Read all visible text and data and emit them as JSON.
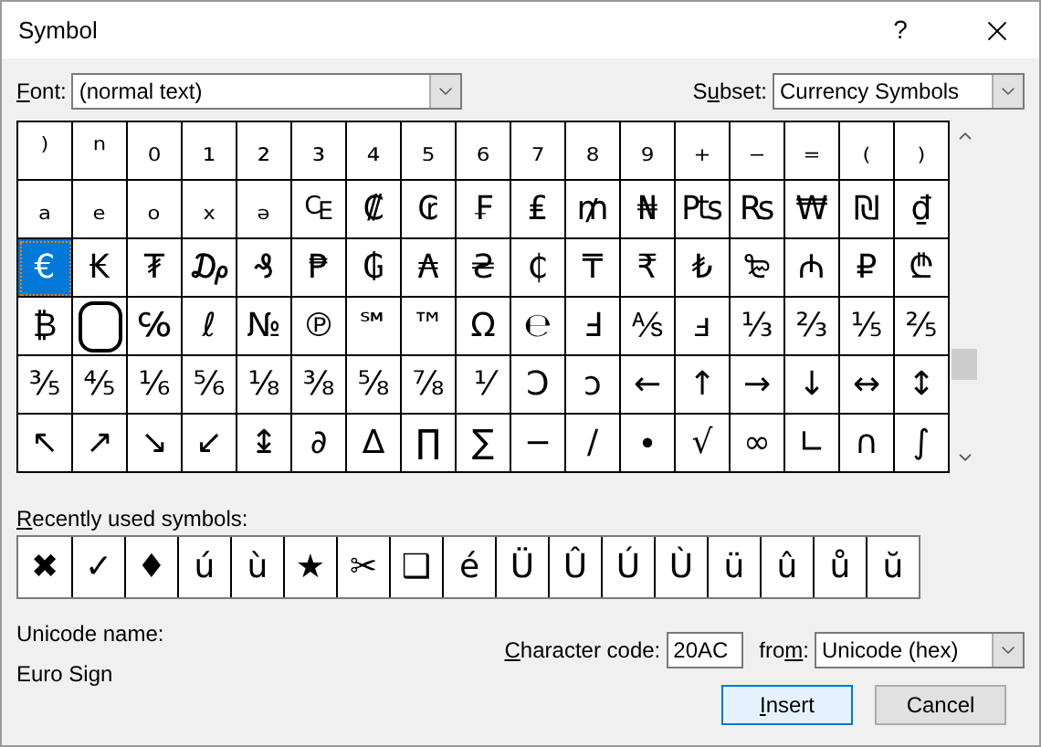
{
  "window": {
    "title": "Symbol",
    "help": "?"
  },
  "font": {
    "label": [
      {
        "text": "F",
        "underline": true
      },
      {
        "text": "ont:",
        "underline": false
      }
    ],
    "value": "(normal text)"
  },
  "subset": {
    "label": [
      {
        "text": "S",
        "underline": false
      },
      {
        "text": "u",
        "underline": true
      },
      {
        "text": "bset:",
        "underline": false
      }
    ],
    "value": "Currency Symbols"
  },
  "symbol_grid": [
    [
      {
        "char": "⁾",
        "selected": false
      },
      {
        "char": "ⁿ",
        "selected": false
      },
      {
        "char": "₀",
        "selected": false
      },
      {
        "char": "₁",
        "selected": false
      },
      {
        "char": "₂",
        "selected": false
      },
      {
        "char": "₃",
        "selected": false
      },
      {
        "char": "₄",
        "selected": false
      },
      {
        "char": "₅",
        "selected": false
      },
      {
        "char": "₆",
        "selected": false
      },
      {
        "char": "₇",
        "selected": false
      },
      {
        "char": "₈",
        "selected": false
      },
      {
        "char": "₉",
        "selected": false
      },
      {
        "char": "₊",
        "selected": false
      },
      {
        "char": "₋",
        "selected": false
      },
      {
        "char": "₌",
        "selected": false
      },
      {
        "char": "₍",
        "selected": false
      },
      {
        "char": "₎",
        "selected": false
      }
    ],
    [
      {
        "char": "ₐ",
        "selected": false
      },
      {
        "char": "ₑ",
        "selected": false
      },
      {
        "char": "ₒ",
        "selected": false
      },
      {
        "char": "ₓ",
        "selected": false
      },
      {
        "char": "ₔ",
        "selected": false
      },
      {
        "char": "₠",
        "selected": false
      },
      {
        "char": "₡",
        "selected": false
      },
      {
        "char": "₢",
        "selected": false
      },
      {
        "char": "₣",
        "selected": false
      },
      {
        "char": "₤",
        "selected": false
      },
      {
        "char": "₥",
        "selected": false
      },
      {
        "char": "₦",
        "selected": false
      },
      {
        "char": "₧",
        "selected": false
      },
      {
        "char": "₨",
        "selected": false
      },
      {
        "char": "₩",
        "selected": false
      },
      {
        "char": "₪",
        "selected": false
      },
      {
        "char": "₫",
        "selected": false
      }
    ],
    [
      {
        "char": "€",
        "selected": true
      },
      {
        "char": "₭",
        "selected": false
      },
      {
        "char": "₮",
        "selected": false
      },
      {
        "char": "₯",
        "selected": false
      },
      {
        "char": "₰",
        "selected": false
      },
      {
        "char": "₱",
        "selected": false
      },
      {
        "char": "₲",
        "selected": false
      },
      {
        "char": "₳",
        "selected": false
      },
      {
        "char": "₴",
        "selected": false
      },
      {
        "char": "₵",
        "selected": false
      },
      {
        "char": "₸",
        "selected": false
      },
      {
        "char": "₹",
        "selected": false
      },
      {
        "char": "₺",
        "selected": false
      },
      {
        "char": "₻",
        "selected": false
      },
      {
        "char": "₼",
        "selected": false
      },
      {
        "char": "₽",
        "selected": false
      },
      {
        "char": "₾",
        "selected": false
      }
    ],
    [
      {
        "char": "₿",
        "selected": false
      },
      {
        "kind": "missing",
        "selected": false
      },
      {
        "char": "℅",
        "selected": false
      },
      {
        "char": "ℓ",
        "selected": false
      },
      {
        "char": "№",
        "selected": false
      },
      {
        "char": "℗",
        "selected": false
      },
      {
        "char": "℠",
        "selected": false
      },
      {
        "char": "™",
        "selected": false
      },
      {
        "char": "Ω",
        "selected": false
      },
      {
        "char": "℮",
        "selected": false
      },
      {
        "char": "Ⅎ",
        "selected": false
      },
      {
        "char": "⅍",
        "selected": false
      },
      {
        "char": "ⅎ",
        "selected": false
      },
      {
        "char": "⅓",
        "selected": false
      },
      {
        "char": "⅔",
        "selected": false
      },
      {
        "char": "⅕",
        "selected": false
      },
      {
        "char": "⅖",
        "selected": false
      }
    ],
    [
      {
        "char": "⅗",
        "selected": false
      },
      {
        "char": "⅘",
        "selected": false
      },
      {
        "char": "⅙",
        "selected": false
      },
      {
        "char": "⅚",
        "selected": false
      },
      {
        "char": "⅛",
        "selected": false
      },
      {
        "char": "⅜",
        "selected": false
      },
      {
        "char": "⅝",
        "selected": false
      },
      {
        "char": "⅞",
        "selected": false
      },
      {
        "char": "⅟",
        "selected": false
      },
      {
        "char": "Ↄ",
        "selected": false
      },
      {
        "char": "ↄ",
        "selected": false
      },
      {
        "char": "←",
        "selected": false
      },
      {
        "char": "↑",
        "selected": false
      },
      {
        "char": "→",
        "selected": false
      },
      {
        "char": "↓",
        "selected": false
      },
      {
        "char": "↔",
        "selected": false
      },
      {
        "char": "↕",
        "selected": false
      }
    ],
    [
      {
        "char": "↖",
        "selected": false
      },
      {
        "char": "↗",
        "selected": false
      },
      {
        "char": "↘",
        "selected": false
      },
      {
        "char": "↙",
        "selected": false
      },
      {
        "char": "↨",
        "selected": false
      },
      {
        "char": "∂",
        "selected": false
      },
      {
        "char": "∆",
        "selected": false
      },
      {
        "char": "∏",
        "selected": false
      },
      {
        "char": "∑",
        "selected": false
      },
      {
        "char": "−",
        "selected": false
      },
      {
        "char": "∕",
        "selected": false
      },
      {
        "char": "∙",
        "selected": false
      },
      {
        "char": "√",
        "selected": false
      },
      {
        "char": "∞",
        "selected": false
      },
      {
        "char": "∟",
        "selected": false
      },
      {
        "char": "∩",
        "selected": false
      },
      {
        "char": "∫",
        "selected": false
      }
    ]
  ],
  "recent": {
    "label": [
      {
        "text": "R",
        "underline": true
      },
      {
        "text": "ecently used symbols:",
        "underline": false
      }
    ],
    "symbols": [
      "✖",
      "✓",
      "♦",
      "ú",
      "ù",
      "★",
      "✂",
      "❑",
      "é",
      "Ü",
      "Û",
      "Ú",
      "Ù",
      "ü",
      "û",
      "ů",
      "ŭ"
    ]
  },
  "unicode_name": {
    "label": "Unicode name:",
    "value": "Euro Sign"
  },
  "character_code": {
    "label": [
      {
        "text": "C",
        "underline": true
      },
      {
        "text": "haracter code:",
        "underline": false
      }
    ],
    "value": "20AC"
  },
  "from": {
    "label": [
      {
        "text": "fro",
        "underline": false
      },
      {
        "text": "m",
        "underline": true
      },
      {
        "text": ":",
        "underline": false
      }
    ],
    "value": "Unicode (hex)"
  },
  "buttons": [
    {
      "label": [
        {
          "text": "I",
          "underline": true
        },
        {
          "text": "nsert",
          "underline": false
        }
      ],
      "default": true
    },
    {
      "label": [
        {
          "text": "Cancel",
          "underline": false
        }
      ],
      "default": false
    }
  ]
}
